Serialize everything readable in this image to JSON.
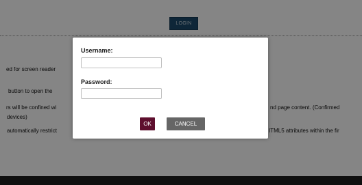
{
  "header": {
    "login_label": "LOGIN"
  },
  "background": {
    "lines": [
      "ed for screen reader",
      "button to open the",
      "rs will be confined wi",
      "devices)",
      "automatically restrict",
      "nd page content. (Confirmed",
      "ITML5 attributes within the fir"
    ]
  },
  "dialog": {
    "username_label": "Username:",
    "username_value": "",
    "password_label": "Password:",
    "password_value": "",
    "ok_label": "OK",
    "cancel_label": "CANCEL"
  },
  "colors": {
    "login_button": "#1c4a6b",
    "ok_button": "#5e0f2e",
    "cancel_button": "#666666",
    "footer": "#1d1d1d"
  }
}
